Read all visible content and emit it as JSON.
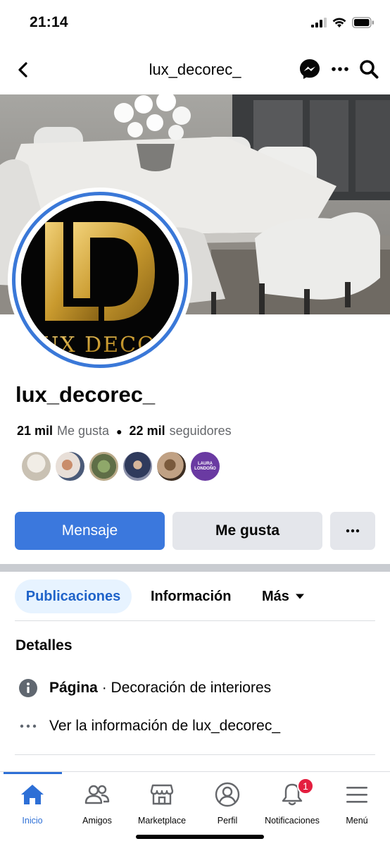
{
  "status_bar": {
    "time": "21:14"
  },
  "header": {
    "title": "lux_decorec_",
    "icons": [
      "back-arrow-icon",
      "messenger-icon",
      "more-dots-icon",
      "search-icon"
    ]
  },
  "cover": {
    "logo_text": "LUX DECOR"
  },
  "page": {
    "name": "lux_decorec_",
    "likes_count": "21 mil",
    "likes_label": "Me gusta",
    "followers_count": "22 mil",
    "followers_label": "seguidores"
  },
  "friend_badge_text": "LAURA LONDOÑO",
  "actions": {
    "message": "Mensaje",
    "like": "Me gusta",
    "more": "···"
  },
  "tabs": {
    "posts": "Publicaciones",
    "info": "Información",
    "more": "Más"
  },
  "details": {
    "title": "Detalles",
    "category_label": "Página",
    "category_sep": " · ",
    "category_value": "Decoración de interiores",
    "see_info": "Ver la información de lux_decorec_"
  },
  "tabbar": {
    "items": [
      {
        "label": "Inicio",
        "icon": "home-icon"
      },
      {
        "label": "Amigos",
        "icon": "friends-icon"
      },
      {
        "label": "Marketplace",
        "icon": "marketplace-icon"
      },
      {
        "label": "Perfil",
        "icon": "profile-icon"
      },
      {
        "label": "Notificaciones",
        "icon": "bell-icon"
      },
      {
        "label": "Menú",
        "icon": "menu-icon"
      }
    ],
    "notification_count": "1"
  },
  "colors": {
    "accent": "#3b78dd",
    "active_tab_bg": "#e7f3ff",
    "badge": "#e41e3f",
    "gold": "#d4a93c"
  }
}
